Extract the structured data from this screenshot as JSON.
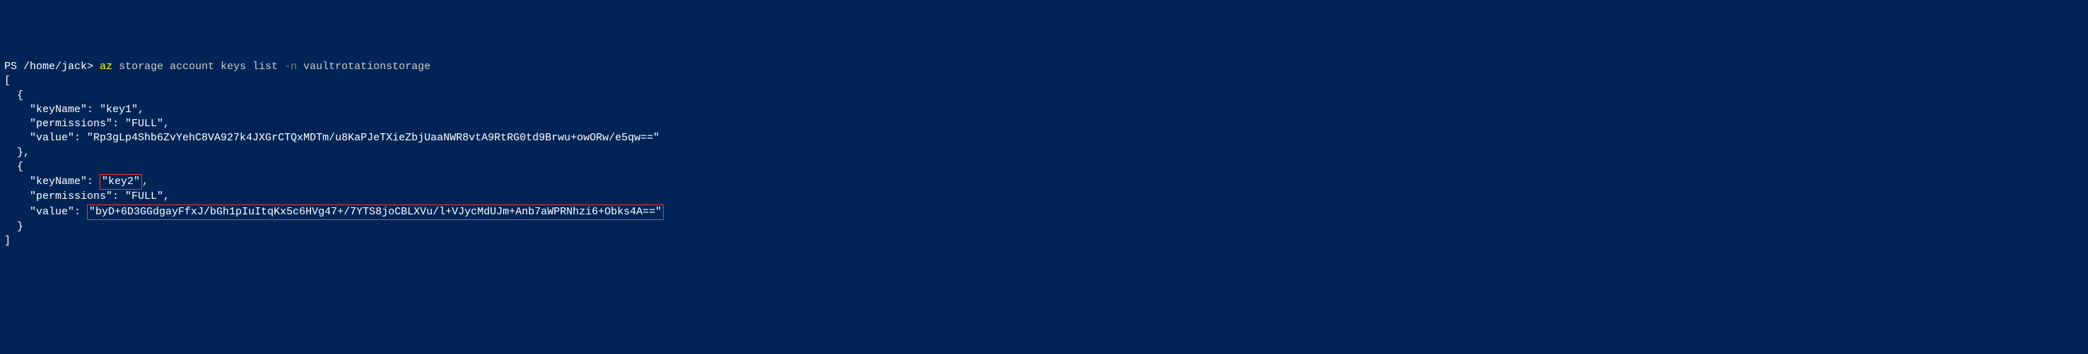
{
  "prompt": {
    "ps": "PS ",
    "path": "/home/jack",
    "sep": "> ",
    "cmd_az": "az",
    "cmd_rest1": " storage account keys list ",
    "cmd_flag": "-n",
    "cmd_rest2": " vaultrotationstorage"
  },
  "output": {
    "line_open_bracket": "[",
    "obj1_open": "  {",
    "obj1_keyname": "    \"keyName\": \"key1\",",
    "obj1_permissions": "    \"permissions\": \"FULL\",",
    "obj1_value": "    \"value\": \"Rp3gLp4Shb6ZvYehC8VA927k4JXGrCTQxMDTm/u8KaPJeTXieZbjUaaNWR8vtA9RtRG0td9Brwu+owORw/e5qw==\"",
    "obj1_close": "  },",
    "obj2_open": "  {",
    "obj2_keyname_pre": "    \"keyName\": ",
    "obj2_keyname_hl": "\"key2\"",
    "obj2_keyname_post": ",",
    "obj2_permissions": "    \"permissions\": \"FULL\",",
    "obj2_value_pre": "    \"value\": ",
    "obj2_value_hl": "\"byD+6D3GGdgayFfxJ/bGh1pIuItqKx5c6HVg47+/7YTS8joCBLXVu/l+VJycMdUJm+Anb7aWPRNhzi6+Obks4A==\"",
    "obj2_close": "  }",
    "line_close_bracket": "]"
  },
  "chart_data": {
    "type": "table",
    "title": "Azure Storage Account Keys List Output",
    "series": [
      {
        "keyName": "key1",
        "permissions": "FULL",
        "value": "Rp3gLp4Shb6ZvYehC8VA927k4JXGrCTQxMDTm/u8KaPJeTXieZbjUaaNWR8vtA9RtRG0td9Brwu+owORw/e5qw=="
      },
      {
        "keyName": "key2",
        "permissions": "FULL",
        "value": "byD+6D3GGdgayFfxJ/bGh1pIuItqKx5c6HVg47+/7YTS8joCBLXVu/l+VJycMdUJm+Anb7aWPRNhzi6+Obks4A=="
      }
    ]
  }
}
